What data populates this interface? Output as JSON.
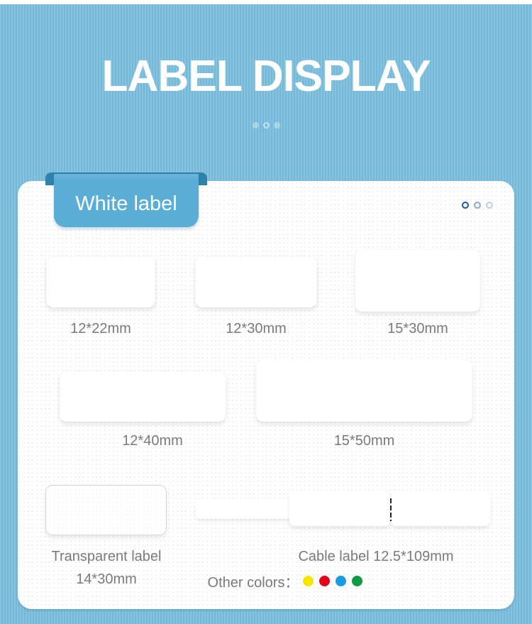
{
  "header": {
    "title": "LABEL DISPLAY",
    "pager_dots": 3,
    "pager_active_index": 1
  },
  "card": {
    "tab_label": "White label",
    "pager_dots": 3,
    "pager_active_index": 0
  },
  "labels": [
    {
      "name": "label-12x22",
      "caption": "12*22mm"
    },
    {
      "name": "label-12x30",
      "caption": "12*30mm"
    },
    {
      "name": "label-15x30",
      "caption": "15*30mm"
    },
    {
      "name": "label-12x40",
      "caption": "12*40mm"
    },
    {
      "name": "label-15x50",
      "caption": "15*50mm"
    }
  ],
  "transparent_label": {
    "title": "Transparent label",
    "size": "14*30mm"
  },
  "cable_label": {
    "title": "Cable label 12.5*109mm",
    "other_colors_label": "Other colors：",
    "colors": [
      {
        "name": "yellow",
        "hex": "#f5e600"
      },
      {
        "name": "red",
        "hex": "#e3001b"
      },
      {
        "name": "blue",
        "hex": "#149be0"
      },
      {
        "name": "green",
        "hex": "#0f9a47"
      }
    ]
  },
  "theme": {
    "background": "#7bbfde",
    "tab_color": "#5aaed5",
    "dot_active": "#1f50b8"
  }
}
